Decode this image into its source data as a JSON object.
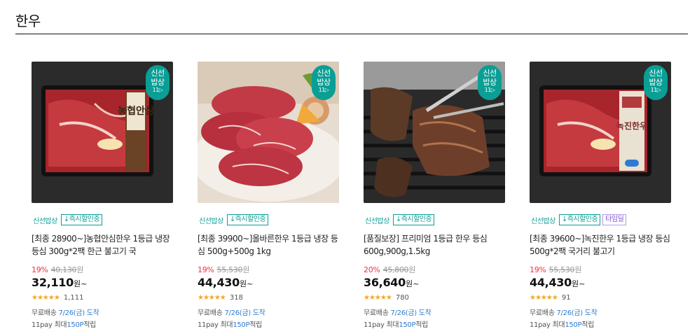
{
  "section": {
    "title": "한우"
  },
  "badge": {
    "line1": "신선",
    "line2": "밥상",
    "mark": "11▷"
  },
  "products": [
    {
      "tag_fresh": "신선밥상",
      "tag_discount": "↓즉시할인중",
      "tag_timedeal": "",
      "name": "[최종 28900~]농협안심한우 1등급 냉장 등심 300g*2팩 한근 불고기 국",
      "rate": "19%",
      "original_price": "40,130",
      "original_unit": "원",
      "price": "32,110",
      "price_unit": "원~",
      "stars": "★★★★★",
      "review_count": "1,111",
      "delivery_label": "무료배송",
      "delivery_date": "7/26(금) 도착",
      "point_prefix": "11pay 최대",
      "point_value": "150P",
      "point_suffix": "적립",
      "thumb_package_text": "농협안심"
    },
    {
      "tag_fresh": "신선밥상",
      "tag_discount": "↓즉시할인중",
      "tag_timedeal": "",
      "name": "[최종 39900~]올바른한우 1등급 냉장 등심 500g+500g 1kg",
      "rate": "19%",
      "original_price": "55,530",
      "original_unit": "원",
      "price": "44,430",
      "price_unit": "원~",
      "stars": "★★★★★",
      "review_count": "318",
      "delivery_label": "무료배송",
      "delivery_date": "7/26(금) 도착",
      "point_prefix": "11pay 최대",
      "point_value": "150P",
      "point_suffix": "적립"
    },
    {
      "tag_fresh": "신선밥상",
      "tag_discount": "↓즉시할인중",
      "tag_timedeal": "",
      "name": "[품질보장] 프리미엄 1등급 한우 등심 600g,900g,1.5kg",
      "rate": "20%",
      "original_price": "45,800",
      "original_unit": "원",
      "price": "36,640",
      "price_unit": "원~",
      "stars": "★★★★★",
      "review_count": "780",
      "delivery_label": "무료배송",
      "delivery_date": "7/26(금) 도착",
      "point_prefix": "11pay 최대",
      "point_value": "150P",
      "point_suffix": "적립"
    },
    {
      "tag_fresh": "신선밥상",
      "tag_discount": "↓즉시할인중",
      "tag_timedeal": "타임딜",
      "name": "[최종 39600~]녹진한우 1등급 냉장 등심 500g*2팩 국거리 불고기",
      "rate": "19%",
      "original_price": "55,530",
      "original_unit": "원",
      "price": "44,430",
      "price_unit": "원~",
      "stars": "★★★★★",
      "review_count": "91",
      "delivery_label": "무료배송",
      "delivery_date": "7/26(금) 도착",
      "point_prefix": "11pay 최대",
      "point_value": "150P",
      "point_suffix": "적립",
      "thumb_package_text": "녹진한우"
    }
  ]
}
